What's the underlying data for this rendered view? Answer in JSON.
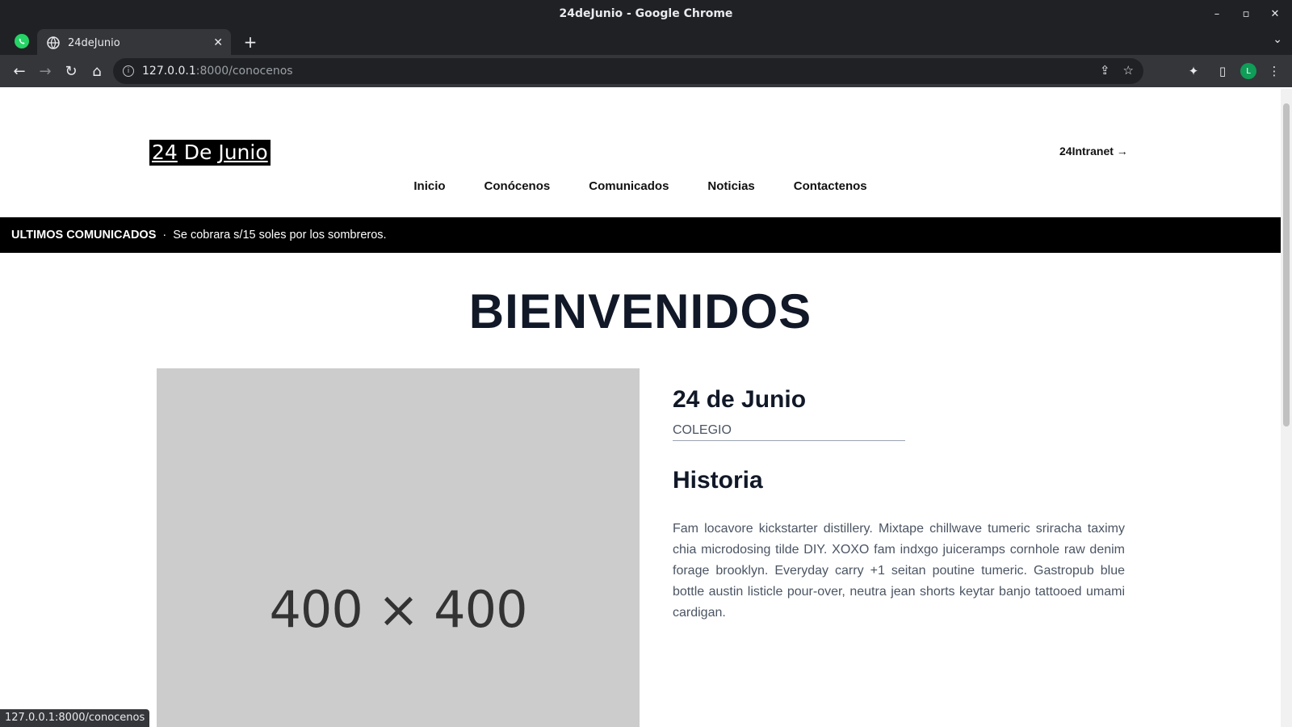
{
  "window": {
    "title": "24deJunio - Google Chrome"
  },
  "tabs": [
    {
      "title": "24deJunio"
    }
  ],
  "address": {
    "host": "127.0.0.1",
    "path": ":8000/conocenos"
  },
  "site": {
    "logo_prefix": "24",
    "logo_middle": " De ",
    "logo_suffix": "Junio",
    "intranet_link": "24Intranet →",
    "nav": [
      "Inicio",
      "Conócenos",
      "Comunicados",
      "Noticias",
      "Contactenos"
    ]
  },
  "ticker": {
    "label": "ULTIMOS COMUNICADOS",
    "separator": "·",
    "message": "Se cobrara s/15 soles por los sombreros."
  },
  "page": {
    "heading": "BIENVENIDOS",
    "image_placeholder": "400 × 400",
    "school_name": "24 de Junio",
    "school_type": "COLEGIO",
    "history_heading": "Historia",
    "history_text": "Fam locavore kickstarter distillery. Mixtape chillwave tumeric sriracha taximy chia microdosing tilde DIY. XOXO fam indxgo juiceramps cornhole raw denim forage brooklyn. Everyday carry +1 seitan poutine tumeric. Gastropub blue bottle austin listicle pour-over, neutra jean shorts keytar banjo tattooed umami cardigan."
  },
  "status_bar": {
    "url": "127.0.0.1:8000/conocenos"
  },
  "icons": [
    "whatsapp-icon",
    "globe-icon",
    "close-icon",
    "plus-icon",
    "back-icon",
    "forward-icon",
    "reload-icon",
    "home-icon",
    "info-icon",
    "share-icon",
    "star-icon",
    "extensions-icon",
    "sidepanel-icon",
    "profile-avatar",
    "more-icon"
  ],
  "colors": {
    "chrome_dark": "#202124",
    "chrome_mid": "#35363a",
    "ticker_bg": "#000000",
    "heading": "#111827",
    "placeholder_bg": "#cccccc"
  }
}
